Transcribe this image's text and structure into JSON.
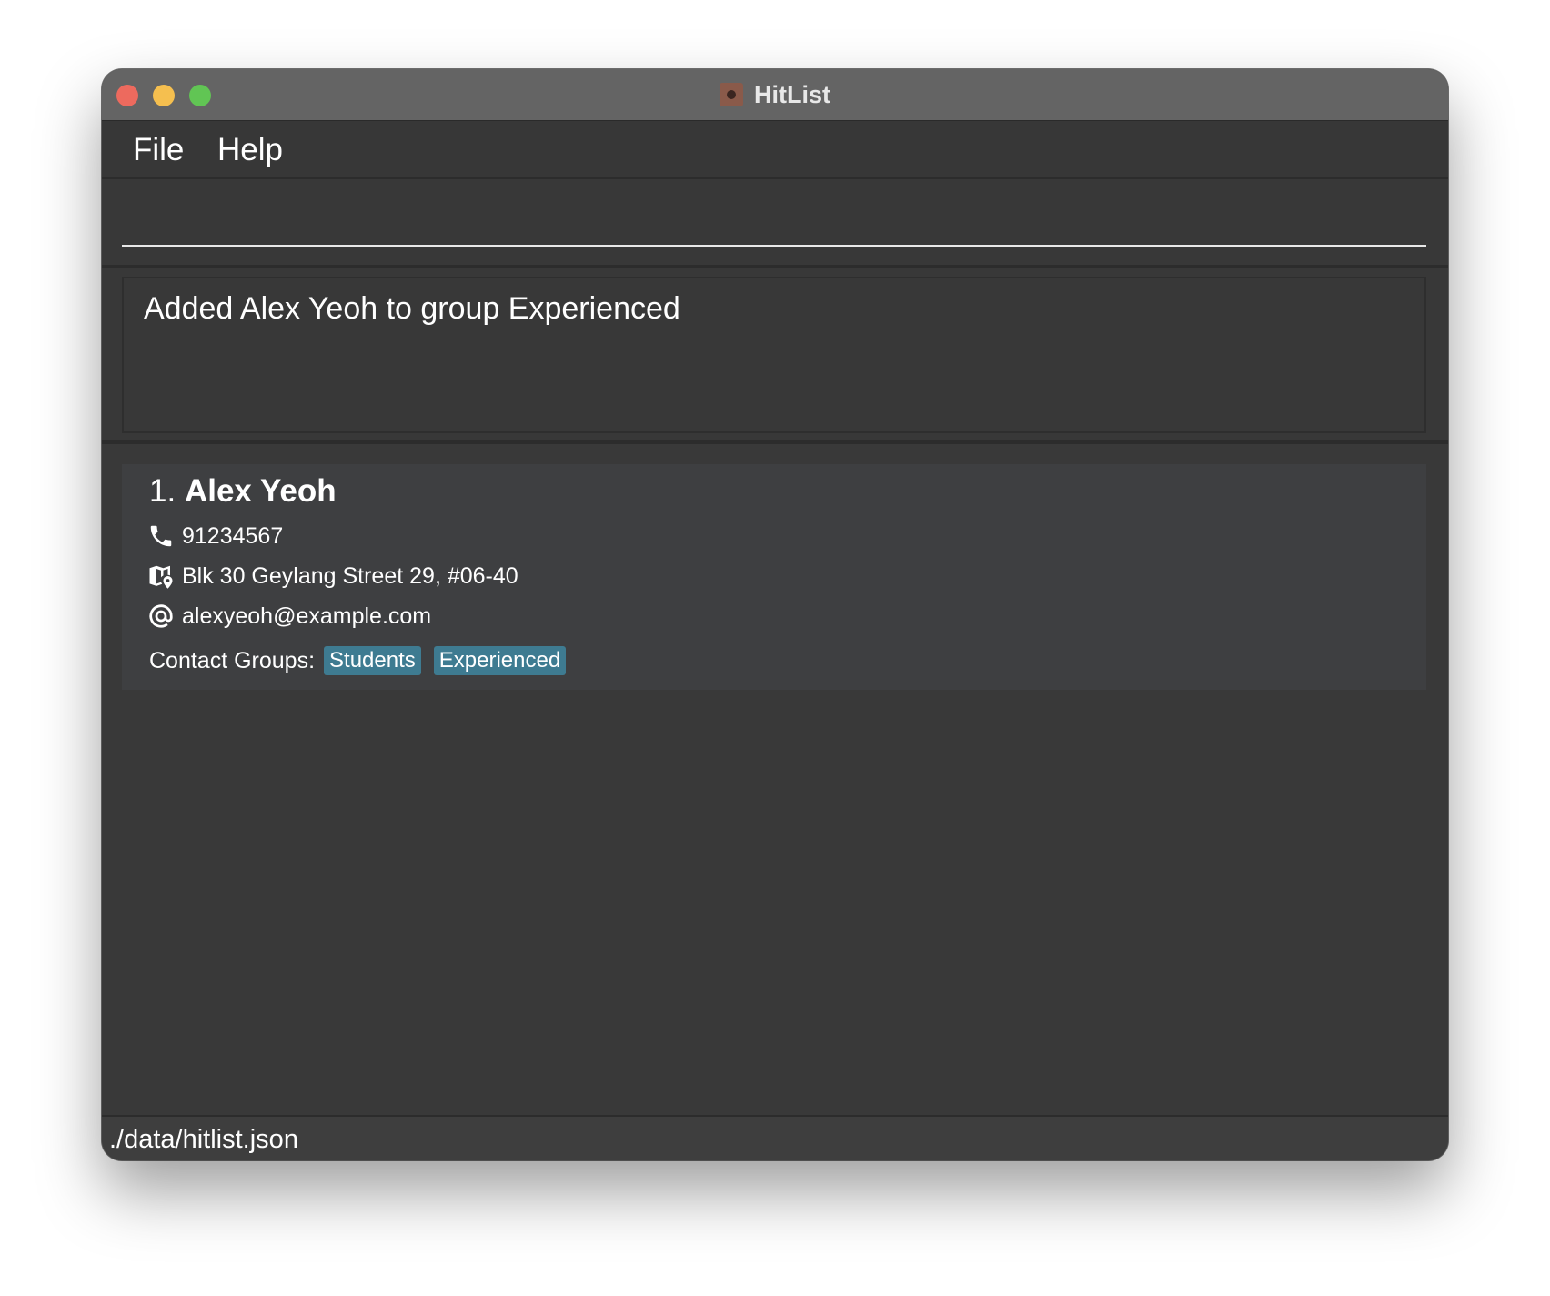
{
  "window": {
    "title": "HitList"
  },
  "menu": {
    "file": "File",
    "help": "Help"
  },
  "command": {
    "value": "",
    "placeholder": ""
  },
  "result": {
    "message": "Added Alex Yeoh to group Experienced"
  },
  "persons": [
    {
      "index": "1.",
      "name": "Alex Yeoh",
      "phone": "91234567",
      "address": "Blk 30 Geylang Street 29, #06-40",
      "email": "alexyeoh@example.com",
      "groups_label": "Contact Groups:",
      "groups": [
        "Students",
        "Experienced"
      ],
      "icons": [
        "phone-icon",
        "map-icon",
        "at-icon"
      ]
    }
  ],
  "status": {
    "file_path": "./data/hitlist.json"
  },
  "colors": {
    "tag": "#3e7b91",
    "titlebar": "#646464",
    "background": "#3a3a3a",
    "card": "#3e3f41",
    "close": "#ed6a5e",
    "minimize": "#f5bf4f",
    "maximize": "#61c554"
  }
}
